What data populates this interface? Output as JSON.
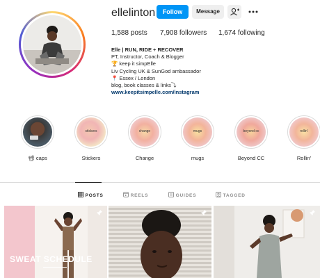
{
  "profile": {
    "username": "ellelinton",
    "follow_label": "Follow",
    "message_label": "Message",
    "posts": "1,588",
    "posts_label": "posts",
    "followers": "7,908",
    "followers_label": "followers",
    "following": "1,674",
    "following_label": "following"
  },
  "bio": {
    "name": "Elle | RUN, RIDE + RECOVER",
    "lines": [
      "PT, Instructor, Coach & Blogger",
      "🏆 keep it simpElle",
      "Liv Cycling UK & SunGod ambassador",
      "📍 Essex / London",
      "blog, book classes & links⤵"
    ],
    "link": "www.keepitsimpelle.com/instagram"
  },
  "highlights": [
    {
      "label": "📽 caps",
      "inner": ""
    },
    {
      "label": "Stickers",
      "inner": "stickers"
    },
    {
      "label": "Change",
      "inner": "change"
    },
    {
      "label": "mugs",
      "inner": "mugs"
    },
    {
      "label": "Beyond CC",
      "inner": "beyond cc"
    },
    {
      "label": "Rollin'",
      "inner": "rollin'"
    }
  ],
  "tabs": [
    {
      "label": "POSTS",
      "icon": "grid-icon"
    },
    {
      "label": "REELS",
      "icon": "reels-icon"
    },
    {
      "label": "GUIDES",
      "icon": "guides-icon"
    },
    {
      "label": "TAGGED",
      "icon": "tagged-icon"
    }
  ],
  "posts": [
    {
      "caption": "SWEAT SCHEDULE"
    }
  ],
  "colors": {
    "follow_button": "#0095f6",
    "link": "#00376b",
    "text": "#262626",
    "muted": "#8e8e8e"
  }
}
